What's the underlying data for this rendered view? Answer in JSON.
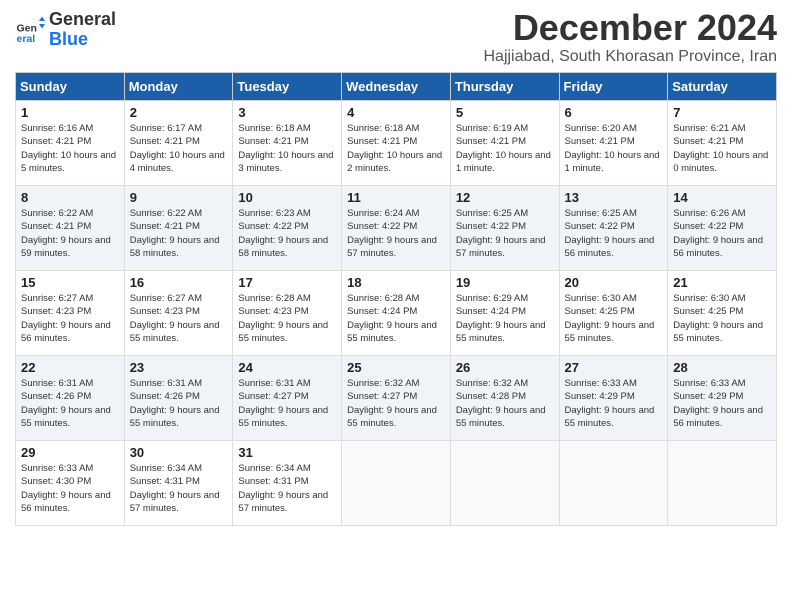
{
  "logo": {
    "text_general": "General",
    "text_blue": "Blue"
  },
  "title": "December 2024",
  "location": "Hajjiabad, South Khorasan Province, Iran",
  "days_of_week": [
    "Sunday",
    "Monday",
    "Tuesday",
    "Wednesday",
    "Thursday",
    "Friday",
    "Saturday"
  ],
  "weeks": [
    [
      {
        "day": "1",
        "sunrise": "6:16 AM",
        "sunset": "4:21 PM",
        "daylight": "10 hours and 5 minutes."
      },
      {
        "day": "2",
        "sunrise": "6:17 AM",
        "sunset": "4:21 PM",
        "daylight": "10 hours and 4 minutes."
      },
      {
        "day": "3",
        "sunrise": "6:18 AM",
        "sunset": "4:21 PM",
        "daylight": "10 hours and 3 minutes."
      },
      {
        "day": "4",
        "sunrise": "6:18 AM",
        "sunset": "4:21 PM",
        "daylight": "10 hours and 2 minutes."
      },
      {
        "day": "5",
        "sunrise": "6:19 AM",
        "sunset": "4:21 PM",
        "daylight": "10 hours and 1 minute."
      },
      {
        "day": "6",
        "sunrise": "6:20 AM",
        "sunset": "4:21 PM",
        "daylight": "10 hours and 1 minute."
      },
      {
        "day": "7",
        "sunrise": "6:21 AM",
        "sunset": "4:21 PM",
        "daylight": "10 hours and 0 minutes."
      }
    ],
    [
      {
        "day": "8",
        "sunrise": "6:22 AM",
        "sunset": "4:21 PM",
        "daylight": "9 hours and 59 minutes."
      },
      {
        "day": "9",
        "sunrise": "6:22 AM",
        "sunset": "4:21 PM",
        "daylight": "9 hours and 58 minutes."
      },
      {
        "day": "10",
        "sunrise": "6:23 AM",
        "sunset": "4:22 PM",
        "daylight": "9 hours and 58 minutes."
      },
      {
        "day": "11",
        "sunrise": "6:24 AM",
        "sunset": "4:22 PM",
        "daylight": "9 hours and 57 minutes."
      },
      {
        "day": "12",
        "sunrise": "6:25 AM",
        "sunset": "4:22 PM",
        "daylight": "9 hours and 57 minutes."
      },
      {
        "day": "13",
        "sunrise": "6:25 AM",
        "sunset": "4:22 PM",
        "daylight": "9 hours and 56 minutes."
      },
      {
        "day": "14",
        "sunrise": "6:26 AM",
        "sunset": "4:22 PM",
        "daylight": "9 hours and 56 minutes."
      }
    ],
    [
      {
        "day": "15",
        "sunrise": "6:27 AM",
        "sunset": "4:23 PM",
        "daylight": "9 hours and 56 minutes."
      },
      {
        "day": "16",
        "sunrise": "6:27 AM",
        "sunset": "4:23 PM",
        "daylight": "9 hours and 55 minutes."
      },
      {
        "day": "17",
        "sunrise": "6:28 AM",
        "sunset": "4:23 PM",
        "daylight": "9 hours and 55 minutes."
      },
      {
        "day": "18",
        "sunrise": "6:28 AM",
        "sunset": "4:24 PM",
        "daylight": "9 hours and 55 minutes."
      },
      {
        "day": "19",
        "sunrise": "6:29 AM",
        "sunset": "4:24 PM",
        "daylight": "9 hours and 55 minutes."
      },
      {
        "day": "20",
        "sunrise": "6:30 AM",
        "sunset": "4:25 PM",
        "daylight": "9 hours and 55 minutes."
      },
      {
        "day": "21",
        "sunrise": "6:30 AM",
        "sunset": "4:25 PM",
        "daylight": "9 hours and 55 minutes."
      }
    ],
    [
      {
        "day": "22",
        "sunrise": "6:31 AM",
        "sunset": "4:26 PM",
        "daylight": "9 hours and 55 minutes."
      },
      {
        "day": "23",
        "sunrise": "6:31 AM",
        "sunset": "4:26 PM",
        "daylight": "9 hours and 55 minutes."
      },
      {
        "day": "24",
        "sunrise": "6:31 AM",
        "sunset": "4:27 PM",
        "daylight": "9 hours and 55 minutes."
      },
      {
        "day": "25",
        "sunrise": "6:32 AM",
        "sunset": "4:27 PM",
        "daylight": "9 hours and 55 minutes."
      },
      {
        "day": "26",
        "sunrise": "6:32 AM",
        "sunset": "4:28 PM",
        "daylight": "9 hours and 55 minutes."
      },
      {
        "day": "27",
        "sunrise": "6:33 AM",
        "sunset": "4:29 PM",
        "daylight": "9 hours and 55 minutes."
      },
      {
        "day": "28",
        "sunrise": "6:33 AM",
        "sunset": "4:29 PM",
        "daylight": "9 hours and 56 minutes."
      }
    ],
    [
      {
        "day": "29",
        "sunrise": "6:33 AM",
        "sunset": "4:30 PM",
        "daylight": "9 hours and 56 minutes."
      },
      {
        "day": "30",
        "sunrise": "6:34 AM",
        "sunset": "4:31 PM",
        "daylight": "9 hours and 57 minutes."
      },
      {
        "day": "31",
        "sunrise": "6:34 AM",
        "sunset": "4:31 PM",
        "daylight": "9 hours and 57 minutes."
      },
      null,
      null,
      null,
      null
    ]
  ]
}
